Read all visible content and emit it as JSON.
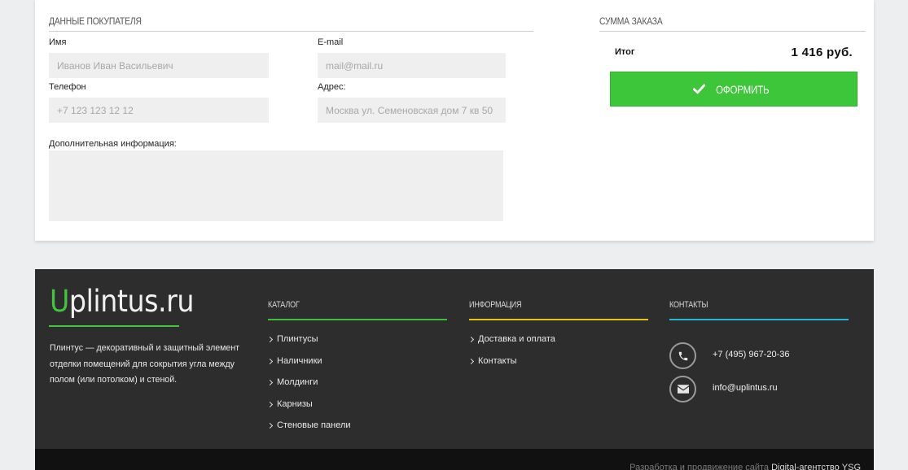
{
  "buyer": {
    "section_title": "Данные покупателя",
    "name_label": "Имя",
    "name_placeholder": "Иванов Иван Васильевич",
    "email_label": "E-mail",
    "email_placeholder": "mail@mail.ru",
    "phone_label": "Телефон",
    "phone_placeholder": "+7 123 123 12 12",
    "address_label": "Адрес:",
    "address_placeholder": "Москва ул. Семеновская дом 7 кв 50",
    "extra_label": "Дополнительная информация:",
    "extra_value": ""
  },
  "order": {
    "section_title": "Сумма заказа",
    "total_label": "Итог",
    "total_value": "1 416 руб.",
    "submit_label": "Оформить",
    "accent_color": "#3ec63a"
  },
  "footer": {
    "logo_first_letter": "U",
    "logo_rest": "plintus.ru",
    "description": "Плинтус — декоративный и защитный элемент отделки помещений для сокрытия угла между полом (или потолком) и стеной.",
    "catalog": {
      "title": "Каталог",
      "color": "#3dbf3a",
      "items": [
        "Плинтусы",
        "Наличники",
        "Молдинги",
        "Карнизы",
        "Стеновые панели"
      ]
    },
    "info": {
      "title": "Информация",
      "color": "#e8c21c",
      "items": [
        "Доставка и оплата",
        "Контакты"
      ]
    },
    "contacts": {
      "title": "Контакты",
      "color": "#25b7d3",
      "phone": "+7 (495) 967-20-36",
      "email": "info@uplintus.ru",
      "phone_icon": "phone-icon",
      "email_icon": "envelope-icon"
    },
    "credit_text": "Разработка и продвижение сайта",
    "credit_link": "Digital-агентство YSG"
  }
}
